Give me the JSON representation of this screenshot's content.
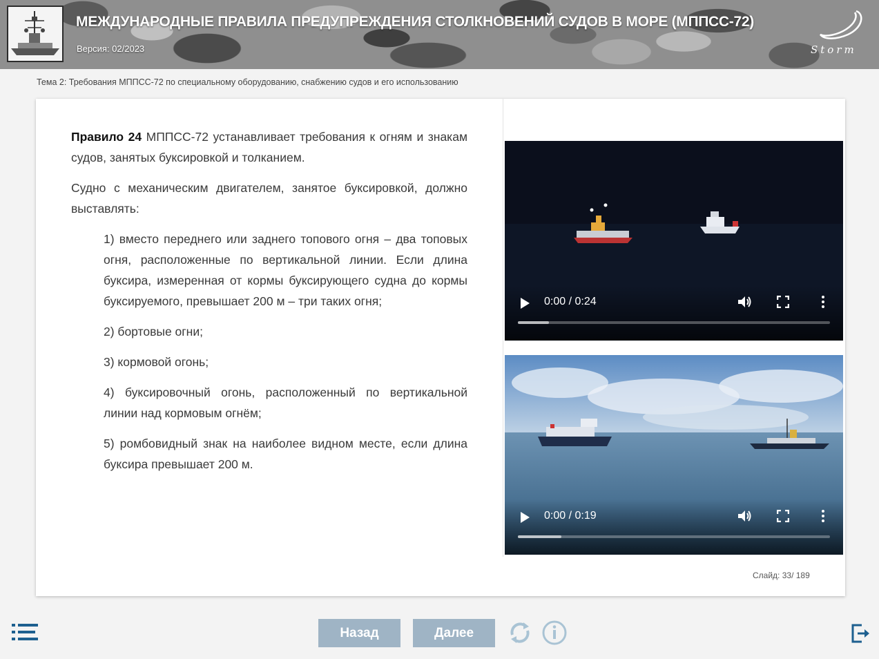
{
  "header": {
    "title": "МЕЖДУНАРОДНЫЕ ПРАВИЛА ПРЕДУПРЕЖДЕНИЯ СТОЛКНОВЕНИЙ СУДОВ В МОРЕ (МППСС-72)",
    "version": "Версия: 02/2023",
    "brand_text": "Storm"
  },
  "breadcrumb": "Тема 2: Требования МППСС-72 по специальному оборудованию, снабжению судов и его использованию",
  "content": {
    "p1_bold": "Правило 24",
    "p1_rest": " МППСС-72 устанавливает требования к огням и знакам судов, занятых буксировкой и толканием.",
    "p2": "Судно с механическим двигателем, занятое буксировкой, должно выставлять:",
    "items": [
      "1) вместо переднего или заднего топового огня – два топовых огня, расположенные по вертикальной линии. Если длина буксира, измеренная от кормы буксирующего судна до кормы буксируемого, превышает 200 м – три таких огня;",
      "2) бортовые огни;",
      "3) кормовой огонь;",
      "4) буксировочный огонь, расположенный по вертикальной линии над кормовым огнём;",
      "5) ромбовидный знак на наиболее видном месте, если длина буксира превышает 200 м."
    ]
  },
  "videos": [
    {
      "time": "0:00 / 0:24",
      "buffered": 0.1
    },
    {
      "time": "0:00 / 0:19",
      "buffered": 0.14
    }
  ],
  "slide_counter": {
    "label": "Слайд:",
    "current": "33",
    "total": "/ 189"
  },
  "nav": {
    "back_label": "Назад",
    "next_label": "Далее"
  },
  "colors": {
    "nav_button": "#9fb4c5",
    "icon_blue": "#1d5f8f",
    "icon_light": "#a9c3d4"
  }
}
